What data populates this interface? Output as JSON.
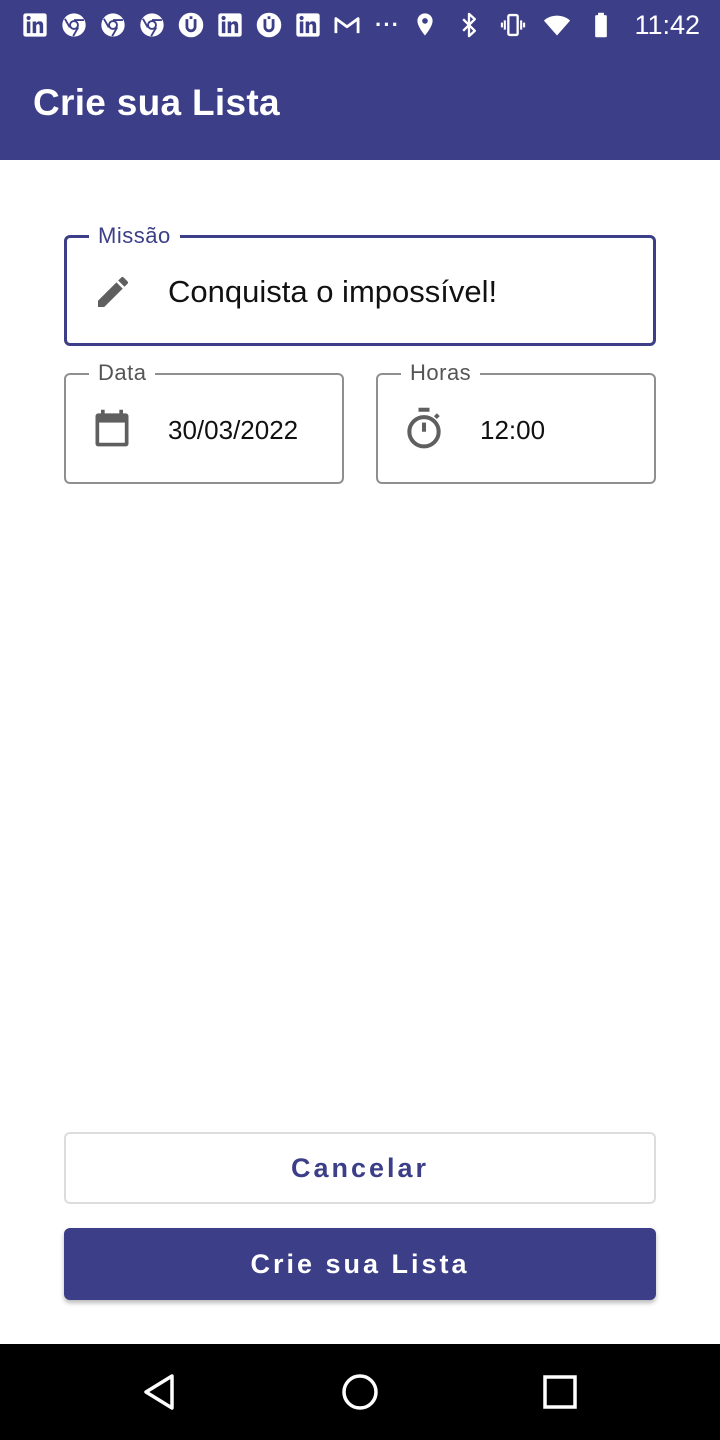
{
  "status_bar": {
    "left_icons": [
      "linkedin-icon",
      "chrome-icon",
      "chrome-icon",
      "chrome-icon",
      "u-app-icon",
      "linkedin-icon",
      "u-app-icon",
      "linkedin-icon",
      "gmail-icon"
    ],
    "overflow": "···",
    "right_icons": [
      "location-icon",
      "bluetooth-icon",
      "vibrate-icon",
      "wifi-icon",
      "battery-icon"
    ],
    "time": "11:42"
  },
  "app_bar": {
    "title": "Crie sua Lista"
  },
  "form": {
    "mission": {
      "label": "Missão",
      "value": "Conquista o impossível!",
      "icon": "pencil-icon"
    },
    "date": {
      "label": "Data",
      "value": "30/03/2022",
      "icon": "calendar-icon"
    },
    "time": {
      "label": "Horas",
      "value": "12:00",
      "icon": "timer-icon"
    }
  },
  "actions": {
    "cancel_label": "Cancelar",
    "create_label": "Crie sua Lista"
  },
  "colors": {
    "primary": "#3c3e88",
    "icon_gray": "#5f5f5f",
    "outline_gray": "#8f8f8f"
  },
  "nav_bar": {
    "icons": [
      "back-icon",
      "home-icon",
      "recents-icon"
    ]
  }
}
